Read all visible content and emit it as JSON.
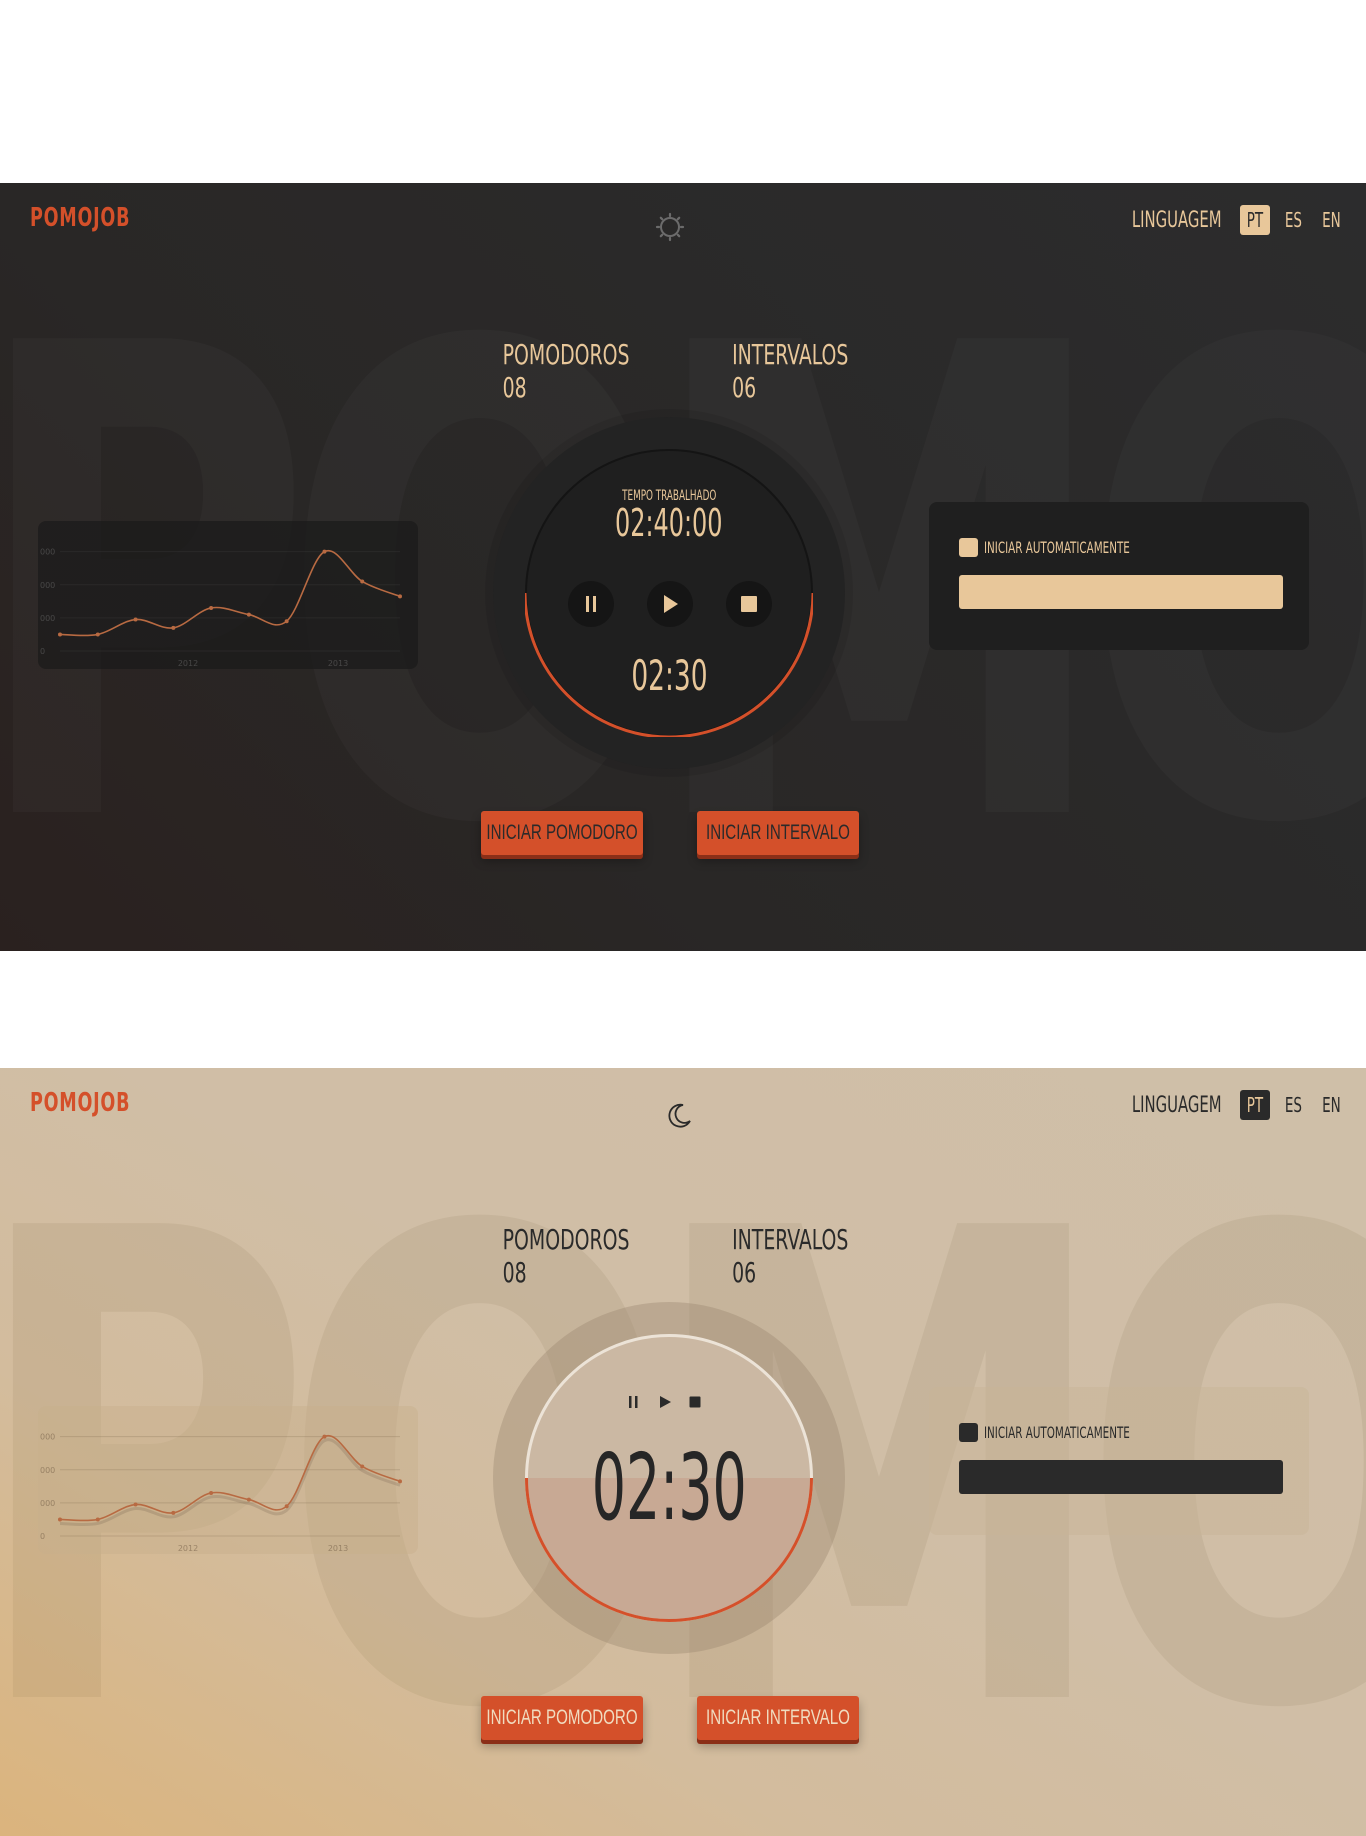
{
  "colors": {
    "accent": "#d4502a",
    "cream": "#e8c79a",
    "dark": "#2a2a2a",
    "chart_line": "#b86a42"
  },
  "app": {
    "logo": "POMOJOB",
    "background_word": "POMOJOB"
  },
  "language": {
    "label": "LINGUAGEM",
    "options": [
      "PT",
      "ES",
      "EN"
    ],
    "active": "PT"
  },
  "counters": {
    "pomodoros": "POMODOROS 08",
    "intervals": "INTERVALOS 06"
  },
  "timer": {
    "worked_label": "TEMPO TRABALHADO",
    "worked_value": "02:40:00",
    "countdown": "02:30",
    "progress": 0.5,
    "controls": [
      "pause-icon",
      "play-icon",
      "stop-icon"
    ]
  },
  "settings": {
    "auto_start_label": "INICIAR AUTOMATICAMENTE",
    "input_value": ""
  },
  "actions": {
    "start_pomodoro": "INICIAR POMODORO",
    "start_interval": "INICIAR INTERVALO"
  },
  "themes": {
    "dark": {
      "toggle_icon": "sun-icon"
    },
    "light": {
      "toggle_icon": "moon-icon"
    }
  },
  "chart_data": {
    "type": "line",
    "x": [
      2011.6,
      2011.75,
      2011.9,
      2012.05,
      2012.2,
      2012.35,
      2012.5,
      2012.65,
      2012.8,
      2012.95,
      2013.1,
      2013.25
    ],
    "xticks": [
      "2012",
      "2013"
    ],
    "yticks": [
      "0",
      "000",
      "000",
      "000"
    ],
    "series": [
      {
        "values": [
          50,
          50,
          95,
          70,
          130,
          110,
          90,
          300,
          210,
          165
        ]
      }
    ],
    "ylim": [
      0,
      320
    ],
    "grid": true
  }
}
